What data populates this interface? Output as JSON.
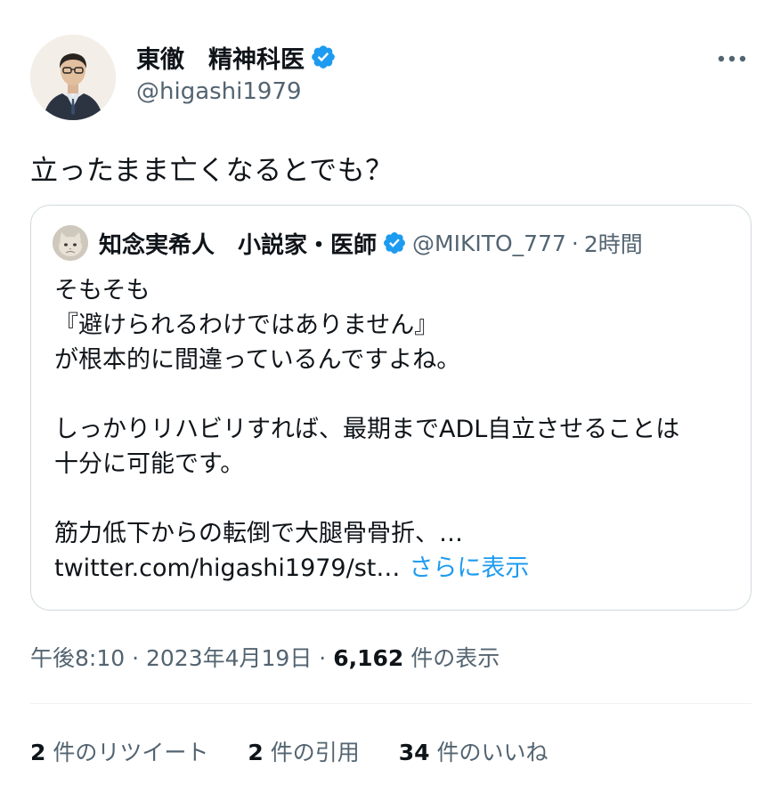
{
  "author": {
    "display_name": "東徹　精神科医",
    "handle": "@higashi1979"
  },
  "tweet": {
    "text": "立ったまま亡くなるとでも？",
    "time": "午後8:10",
    "sep1": "·",
    "date": "2023年4月19日",
    "sep2": "·",
    "views_count": "6,162",
    "views_label": " 件の表示"
  },
  "quote": {
    "display_name": "知念実希人　小説家・医師",
    "handle": "@MIKITO_777",
    "dot": "·",
    "time": "2時間",
    "lines": [
      "そもそも",
      "『避けられるわけではありません』",
      "が根本的に間違っているんですよね。",
      "",
      "しっかりリハビリすれば、最期までADL自立させることは",
      "十分に可能です。",
      "",
      "筋力低下からの転倒で大腿骨骨折、…"
    ],
    "url": "twitter.com/higashi1979/st…",
    "show_more": "さらに表示"
  },
  "stats": {
    "retweets_count": "2",
    "retweets_label": " 件のリツイート",
    "quotes_count": "2",
    "quotes_label": " 件の引用",
    "likes_count": "34",
    "likes_label": " 件のいいね"
  },
  "colors": {
    "accent": "#1d9bf0",
    "secondary_text": "#536471",
    "border": "#cfd9de"
  },
  "icons": {
    "verified": "verified-badge-icon",
    "more": "more-horizontal-icon"
  }
}
